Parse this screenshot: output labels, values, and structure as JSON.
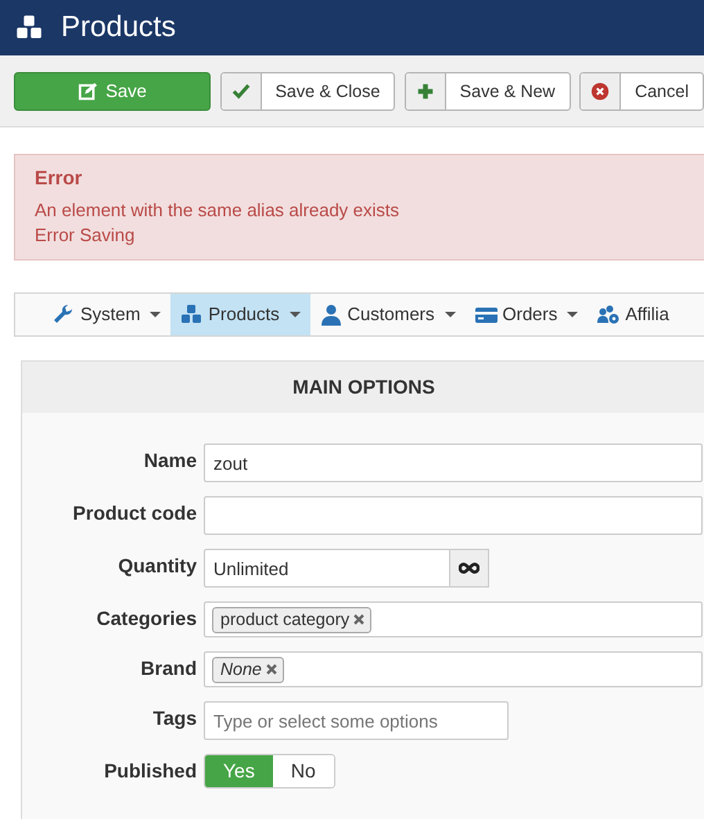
{
  "header": {
    "title": "Products"
  },
  "toolbar": [
    {
      "label": "Save",
      "kind": "primary"
    },
    {
      "label": "Save & Close",
      "kind": "secondary"
    },
    {
      "label": "Save & New",
      "kind": "secondary"
    },
    {
      "label": "Cancel",
      "kind": "secondary"
    }
  ],
  "alert": {
    "heading": "Error",
    "messages": [
      "An element with the same alias already exists",
      "Error Saving"
    ]
  },
  "menu": [
    {
      "label": "System",
      "selected": false
    },
    {
      "label": "Products",
      "selected": true
    },
    {
      "label": "Customers",
      "selected": false
    },
    {
      "label": "Orders",
      "selected": false
    },
    {
      "label": "Affilia",
      "selected": false
    }
  ],
  "panel": {
    "title": "MAIN OPTIONS",
    "fields": [
      {
        "label": "Name",
        "kind": "text",
        "value": "zout"
      },
      {
        "label": "Product code",
        "kind": "text"
      },
      {
        "label": "Quantity",
        "kind": "addon",
        "value": "Unlimited"
      },
      {
        "label": "Categories",
        "kind": "tags",
        "tags": [
          {
            "text": "product category",
            "italic": false
          }
        ]
      },
      {
        "label": "Brand",
        "kind": "tags",
        "tags": [
          {
            "text": "None",
            "italic": true
          }
        ]
      },
      {
        "label": "Tags",
        "kind": "short",
        "placeholder": "Type or select some options"
      },
      {
        "label": "Published",
        "kind": "toggle",
        "options": [
          {
            "label": "Yes",
            "selected": true
          },
          {
            "label": "No",
            "selected": false
          }
        ]
      }
    ]
  }
}
